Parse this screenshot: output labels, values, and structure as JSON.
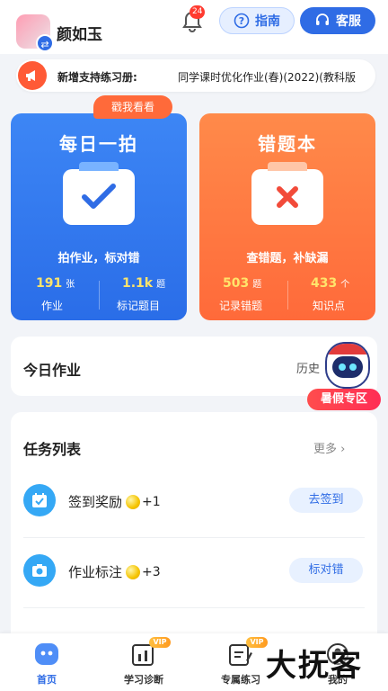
{
  "header": {
    "username": "颜如玉",
    "bell_count": "24",
    "guide_label": "指南",
    "service_label": "客服"
  },
  "notice": {
    "label": "新增支持练习册:",
    "text": "同学课时优化作业(春)(2022)(教科版"
  },
  "cards": {
    "daily": {
      "title": "每日一拍",
      "bubble": "戳我看看",
      "subtitle": "拍作业，标对错",
      "stat1": {
        "value": "191",
        "unit": "张",
        "label": "作业"
      },
      "stat2": {
        "value": "1.1k",
        "unit": "题",
        "label": "标记题目"
      }
    },
    "mistakes": {
      "title": "错题本",
      "subtitle": "查错题，补缺漏",
      "stat1": {
        "value": "503",
        "unit": "题",
        "label": "记录错题"
      },
      "stat2": {
        "value": "433",
        "unit": "个",
        "label": "知识点"
      }
    }
  },
  "today": {
    "title": "今日作业",
    "history": "历史"
  },
  "summer": {
    "label": "暑假专区"
  },
  "tasks": {
    "header": "任务列表",
    "more": "更多",
    "items": [
      {
        "name": "签到奖励",
        "reward": "+1",
        "button": "去签到"
      },
      {
        "name": "作业标注",
        "reward": "+3",
        "button": "标对错"
      }
    ]
  },
  "tabbar": {
    "items": [
      {
        "label": "首页"
      },
      {
        "label": "学习诊断",
        "badge": "VIP"
      },
      {
        "label": "专属练习",
        "badge": "VIP"
      },
      {
        "label": "我的"
      }
    ]
  },
  "watermark": "大抚客",
  "colors": {
    "primary": "#2f6ce5",
    "orange": "#ff6a3a",
    "stat_yellow": "#ffe46b"
  }
}
